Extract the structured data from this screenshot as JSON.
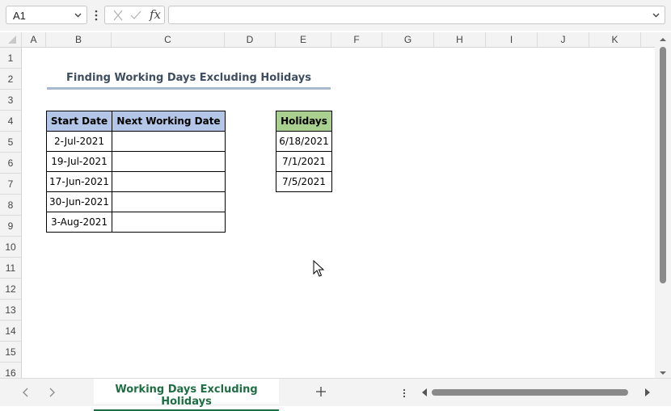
{
  "namebox": {
    "value": "A1"
  },
  "formula_bar": {
    "fx_label": "fx",
    "value": ""
  },
  "columns": [
    "A",
    "B",
    "C",
    "D",
    "E",
    "F",
    "G",
    "H",
    "I",
    "J",
    "K"
  ],
  "rows": [
    "1",
    "2",
    "3",
    "4",
    "5",
    "6",
    "7",
    "8",
    "9",
    "10",
    "11",
    "12",
    "13",
    "14",
    "15",
    "16"
  ],
  "sheet": {
    "title": "Finding Working Days Excluding Holidays",
    "main_table": {
      "headers": [
        "Start Date",
        "Next Working Date"
      ],
      "rows": [
        [
          "2-Jul-2021",
          ""
        ],
        [
          "19-Jul-2021",
          ""
        ],
        [
          "17-Jun-2021",
          ""
        ],
        [
          "30-Jun-2021",
          ""
        ],
        [
          "3-Aug-2021",
          ""
        ]
      ]
    },
    "holidays_table": {
      "header": "Holidays",
      "rows": [
        "6/18/2021",
        "7/1/2021",
        "7/5/2021"
      ]
    }
  },
  "tabs": {
    "active_sheet": "Working Days Excluding Holidays",
    "add_label": "+"
  },
  "colors": {
    "header_blue": "#b4c6e7",
    "header_green": "#a9d08e",
    "title_text": "#3f4d61",
    "active_tab": "#1f6e43"
  },
  "icons": [
    "chevron-down-icon",
    "more-vertical-icon",
    "cancel-icon",
    "check-icon",
    "fx-icon",
    "chevron-left-icon",
    "chevron-right-icon",
    "plus-icon",
    "mouse-pointer-icon"
  ]
}
